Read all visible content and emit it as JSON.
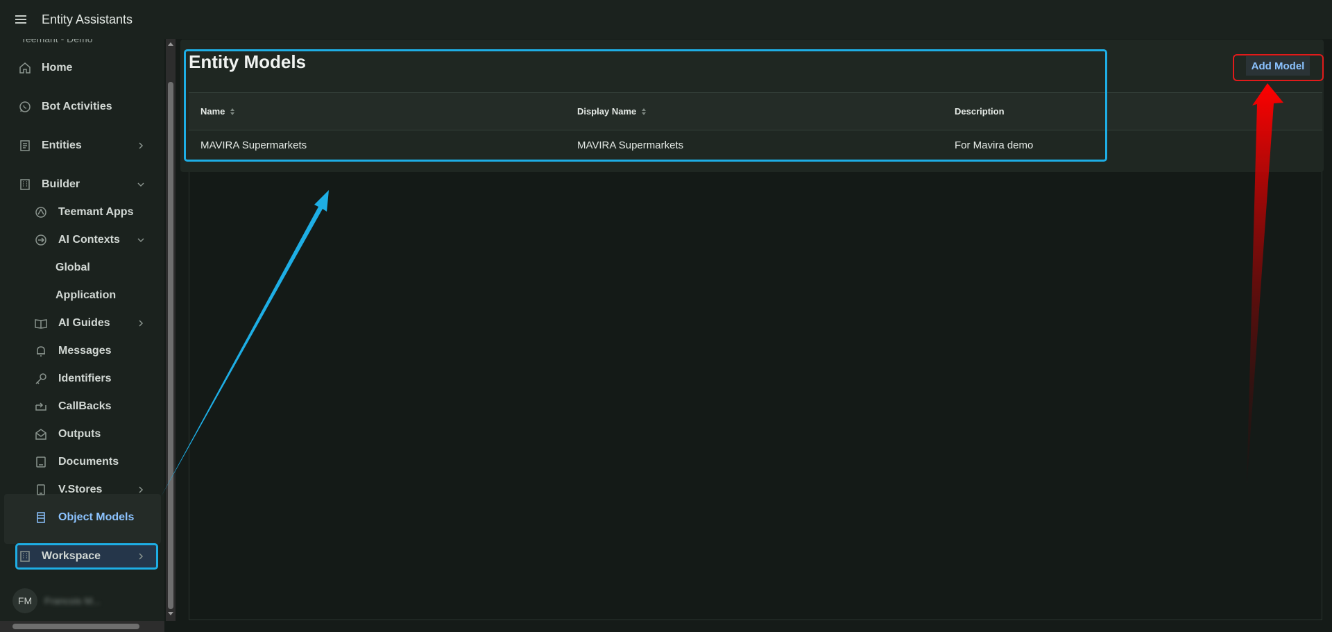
{
  "app": {
    "title": "Entity Assistants",
    "tenant": "Teemant - Demo"
  },
  "sidebar": {
    "items": [
      {
        "label": "Home",
        "icon": "home-icon"
      },
      {
        "label": "Bot Activities",
        "icon": "whatsapp-icon"
      },
      {
        "label": "Entities",
        "icon": "list-doc-icon"
      },
      {
        "label": "Builder",
        "icon": "building-icon"
      },
      {
        "label": "Teemant Apps",
        "icon": "apps-icon"
      },
      {
        "label": "AI Contexts",
        "icon": "arrow-circle-icon"
      },
      {
        "label": "Global"
      },
      {
        "label": "Application"
      },
      {
        "label": "AI Guides",
        "icon": "book-icon"
      },
      {
        "label": "Messages",
        "icon": "bell-icon"
      },
      {
        "label": "Identifiers",
        "icon": "key-icon"
      },
      {
        "label": "CallBacks",
        "icon": "callback-icon"
      },
      {
        "label": "Outputs",
        "icon": "envelope-icon"
      },
      {
        "label": "Documents",
        "icon": "document-icon"
      },
      {
        "label": "V.Stores",
        "icon": "tablet-icon"
      },
      {
        "label": "Object Models",
        "icon": "object-list-icon"
      },
      {
        "label": "Workspace",
        "icon": "building-icon"
      }
    ],
    "user": {
      "initials": "FM",
      "name": "Francois M..."
    }
  },
  "main": {
    "title": "Entity Models",
    "add_button": "Add Model",
    "columns": [
      "Name",
      "Display Name",
      "Description"
    ],
    "rows": [
      {
        "name": "MAVIRA Supermarkets",
        "display_name": "MAVIRA Supermarkets",
        "description": "For Mavira demo"
      }
    ]
  },
  "colors": {
    "accent": "#1eaee5",
    "highlight_red": "#e01b1b",
    "button_text": "#8cc3ff",
    "background": "#151b18"
  }
}
